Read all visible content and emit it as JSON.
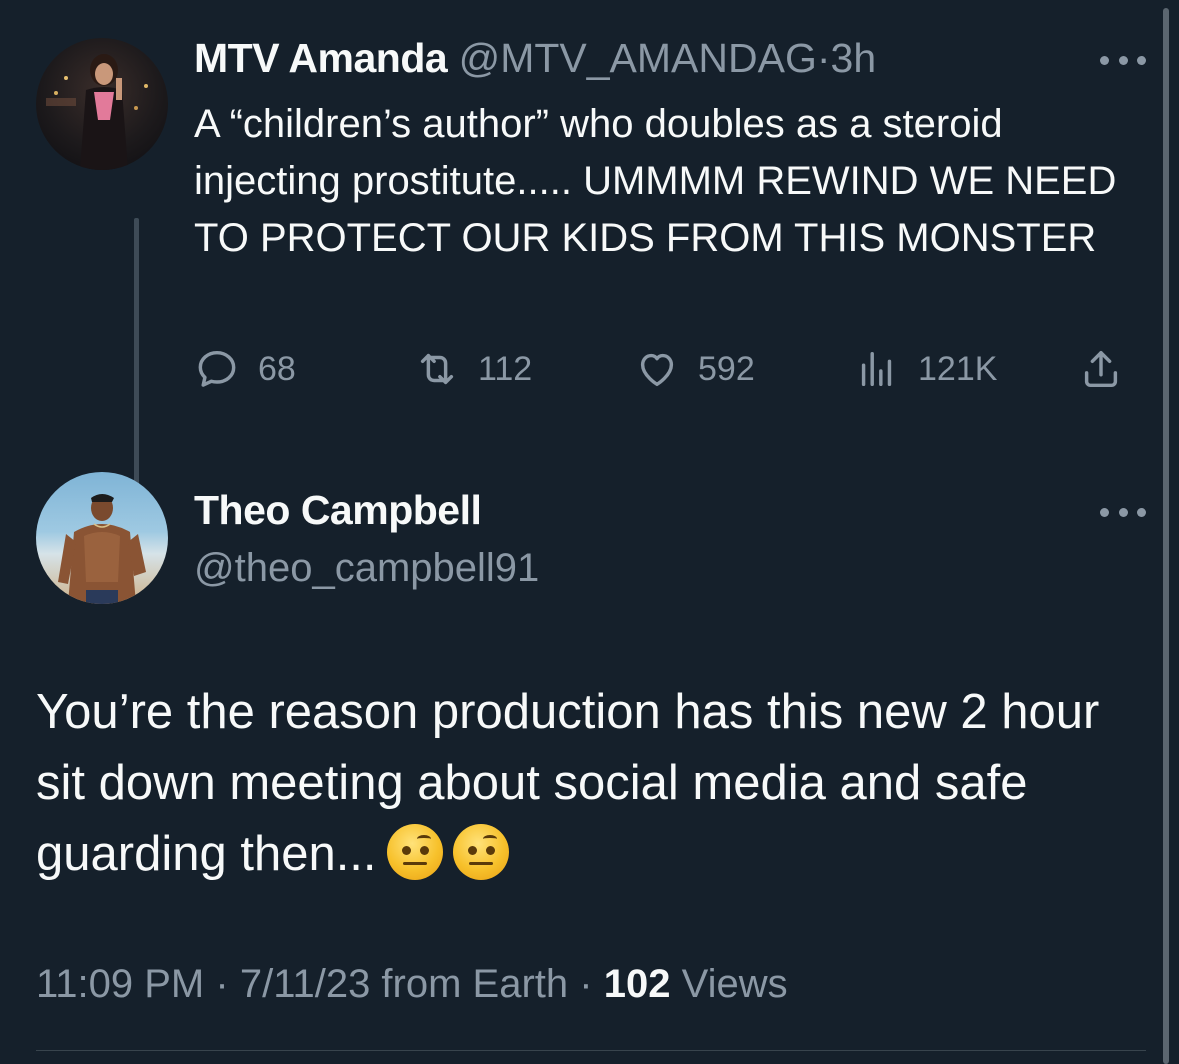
{
  "parent_tweet": {
    "display_name": "MTV Amanda",
    "handle": "@MTV_AMANDAG",
    "separator": "·",
    "time": "3h",
    "text": "A “children’s author” who doubles as a steroid injecting prostitute..... UMMMM REWIND WE NEED TO PROTECT OUR KIDS FROM THIS MONSTER",
    "actions": {
      "replies": "68",
      "retweets": "112",
      "likes": "592",
      "views": "121K"
    },
    "icons": [
      "reply-icon",
      "retweet-icon",
      "like-icon",
      "views-icon",
      "share-icon",
      "more-icon"
    ]
  },
  "reply_tweet": {
    "display_name": "Theo Campbell",
    "handle": "@theo_campbell91",
    "text": "You’re the reason production has this new 2 hour sit down meeting about social media and safe guarding then...",
    "emojis": [
      "face-with-raised-eyebrow",
      "face-with-raised-eyebrow"
    ],
    "meta": {
      "time": "11:09 PM",
      "sep1": "·",
      "date": "7/11/23 from Earth",
      "sep2": "·",
      "views_count": "102",
      "views_label": "Views"
    }
  },
  "colors": {
    "background": "#15202b",
    "text_primary": "#f7f9f9",
    "text_secondary": "#8b98a5",
    "thread_line": "#3e4b57"
  }
}
